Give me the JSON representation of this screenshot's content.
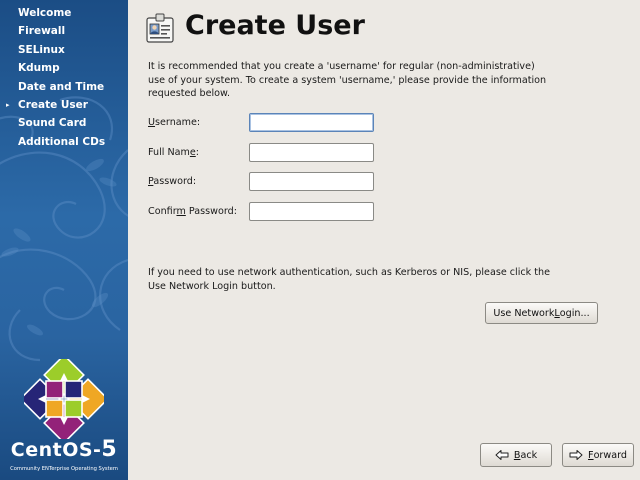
{
  "sidebar": {
    "items": [
      {
        "label": "Welcome",
        "active": false
      },
      {
        "label": "Firewall",
        "active": false
      },
      {
        "label": "SELinux",
        "active": false
      },
      {
        "label": "Kdump",
        "active": false
      },
      {
        "label": "Date and Time",
        "active": false
      },
      {
        "label": "Create User",
        "active": true
      },
      {
        "label": "Sound Card",
        "active": false
      },
      {
        "label": "Additional CDs",
        "active": false
      }
    ],
    "active_marker": "▸",
    "logo": {
      "word": "CentOS",
      "separator": "-",
      "version": "5",
      "tagline": "Community ENTerprise Operating System"
    }
  },
  "main": {
    "title": "Create User",
    "title_icon": "user-id-card-icon",
    "intro": "It is recommended that you create a 'username' for regular (non-administrative) use of your system. To create a system 'username,' please provide the information requested below.",
    "fields": {
      "username": {
        "label_pre": "",
        "label_mnemonic": "U",
        "label_post": "sername:",
        "value": ""
      },
      "fullname": {
        "label_pre": "Full Nam",
        "label_mnemonic": "e",
        "label_post": ":",
        "value": ""
      },
      "password": {
        "label_pre": "",
        "label_mnemonic": "P",
        "label_post": "assword:",
        "value": ""
      },
      "confirm": {
        "label_pre": "Confir",
        "label_mnemonic": "m",
        "label_post": " Password:",
        "value": ""
      }
    },
    "network_text": "If you need to use network authentication, such as Kerberos or NIS, please click the Use Network Login button.",
    "network_button": {
      "pre": "Use Network ",
      "mnemonic": "L",
      "post": "ogin..."
    },
    "back_button": {
      "pre": "",
      "mnemonic": "B",
      "post": "ack",
      "icon": "arrow-left-icon"
    },
    "forward_button": {
      "pre": "",
      "mnemonic": "F",
      "post": "orward",
      "icon": "arrow-right-icon"
    }
  },
  "colors": {
    "sidebar_top": "#1b4d85",
    "sidebar_mid": "#2c6aa8",
    "background": "#ece9e4",
    "focus_border": "#5b84b8"
  }
}
